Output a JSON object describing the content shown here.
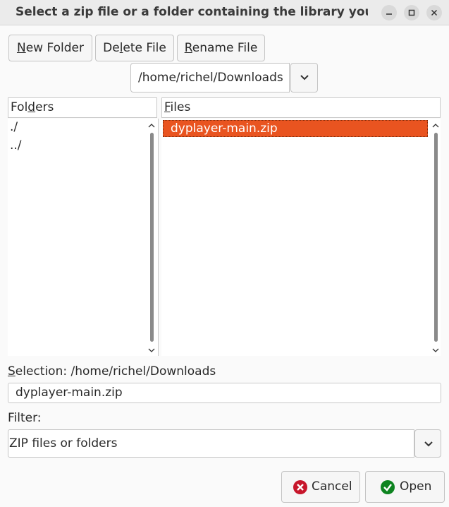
{
  "window": {
    "title": "Select a zip file or a folder containing the library you'd..."
  },
  "toolbar": {
    "new_folder_pre": "",
    "new_folder_key": "N",
    "new_folder_post": "ew Folder",
    "delete_file_pre": "De",
    "delete_file_key": "l",
    "delete_file_post": "ete File",
    "rename_file_pre": "",
    "rename_file_key": "R",
    "rename_file_post": "ename File"
  },
  "path": {
    "current": "/home/richel/Downloads"
  },
  "folders": {
    "header_pre": "Fol",
    "header_key": "d",
    "header_post": "ers",
    "items": [
      "./",
      "../"
    ]
  },
  "files": {
    "header_pre": "",
    "header_key": "F",
    "header_post": "iles",
    "items": [
      "dyplayer-main.zip"
    ]
  },
  "selection": {
    "label_pre": "",
    "label_key": "S",
    "label_post": "election: /home/richel/Downloads",
    "value": "dyplayer-main.zip"
  },
  "filter": {
    "label": "Filter:",
    "value": "ZIP files or folders"
  },
  "actions": {
    "cancel_label": "Cancel",
    "open_label": "Open"
  },
  "colors": {
    "accent": "#e95420",
    "cancel_icon": "#c7162b",
    "open_icon": "#0e8420"
  },
  "icons": {
    "minimize": "minimize-icon",
    "maximize": "maximize-icon",
    "close": "close-icon",
    "dropdown": "chevron-down-icon",
    "cancel": "cancel-icon",
    "open": "check-icon"
  }
}
